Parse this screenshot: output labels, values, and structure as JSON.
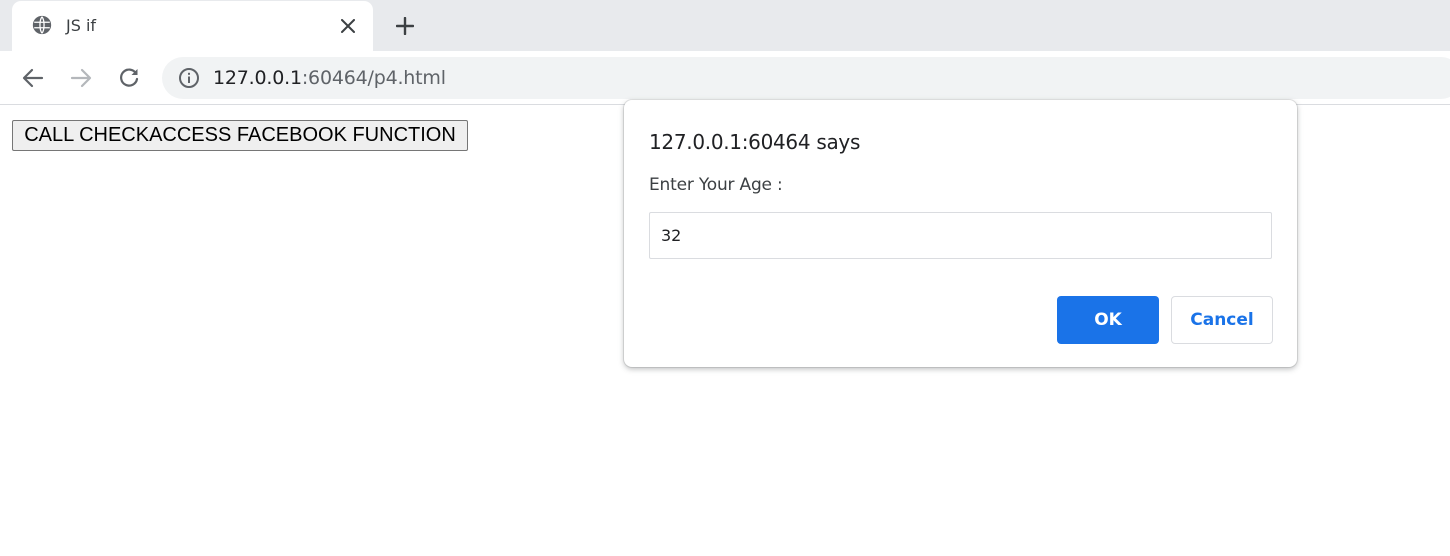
{
  "tab": {
    "title": "JS if",
    "icon": "globe-icon",
    "close_icon": "close-icon"
  },
  "new_tab_icon": "plus-icon",
  "toolbar": {
    "back_icon": "back-arrow-icon",
    "forward_icon": "forward-arrow-icon",
    "reload_icon": "reload-icon",
    "info_icon": "info-icon",
    "url_host": "127.0.0.1",
    "url_rest": ":60464/p4.html"
  },
  "page": {
    "button_label": "CALL CHECKACCESS FACEBOOK FUNCTION"
  },
  "dialog": {
    "title": "127.0.0.1:60464 says",
    "message": "Enter Your Age :",
    "input_value": "32",
    "ok_label": "OK",
    "cancel_label": "Cancel"
  },
  "colors": {
    "tabstrip": "#e8eaed",
    "omnibox": "#f1f3f4",
    "accent": "#1a73e8"
  }
}
